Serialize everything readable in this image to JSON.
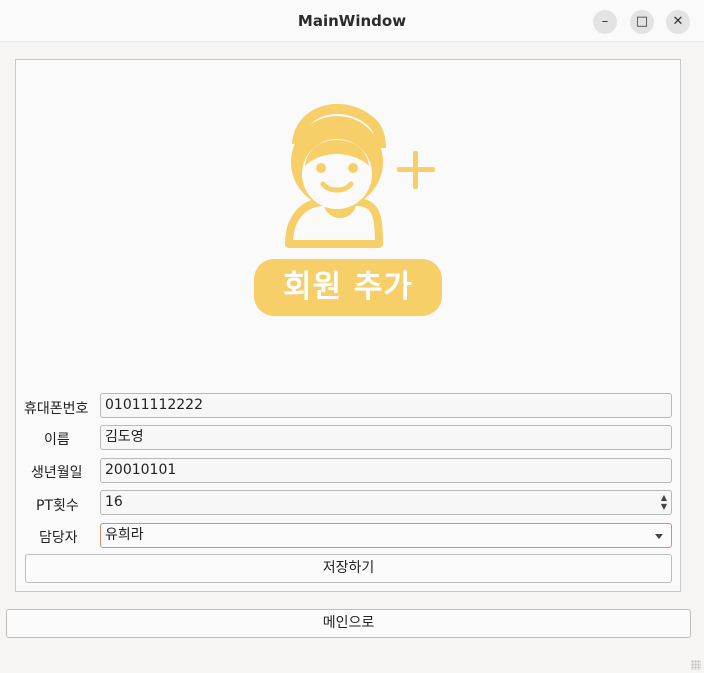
{
  "window": {
    "title": "MainWindow",
    "minimize": "–",
    "maximize": "□",
    "close": "✕"
  },
  "hero": {
    "icon": "person-add-icon",
    "badge_text": "회원 추가",
    "accent_color": "#f6cf68"
  },
  "form": {
    "phone": {
      "label": "휴대폰번호",
      "value": "01011112222"
    },
    "name": {
      "label": "이름",
      "value": "김도영"
    },
    "birth": {
      "label": "생년월일",
      "value": "20010101"
    },
    "pt_count": {
      "label": "PT횟수",
      "value": "16"
    },
    "trainer": {
      "label": "담당자",
      "value": "유희라"
    }
  },
  "buttons": {
    "save": "저장하기",
    "main": "메인으로"
  }
}
